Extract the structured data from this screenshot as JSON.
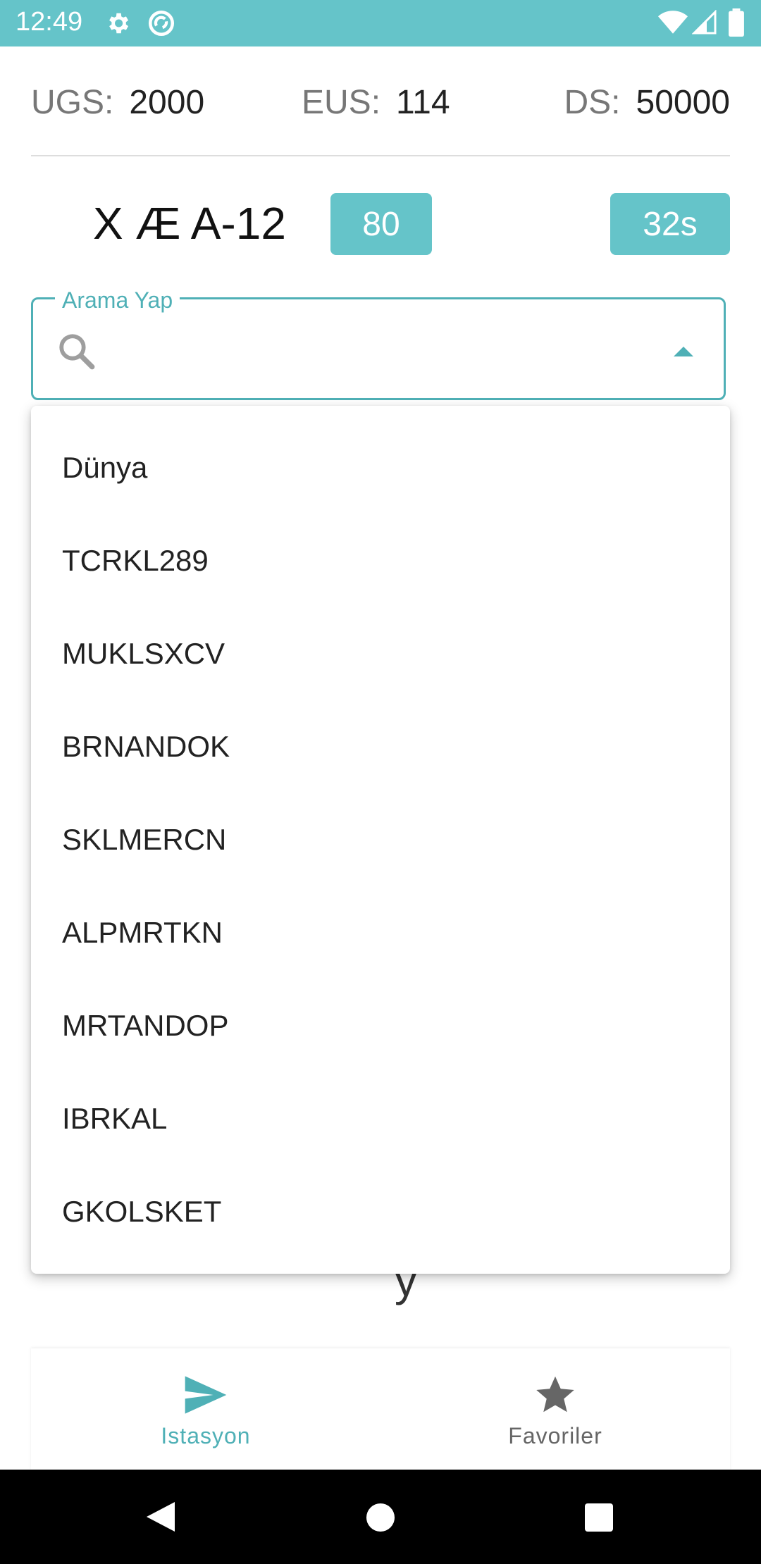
{
  "status_bar": {
    "time": "12:49",
    "icons": [
      "gear-icon",
      "sync-icon",
      "wifi-icon",
      "signal-icon",
      "battery-icon"
    ],
    "background": "#65c4c9"
  },
  "stats": {
    "ugs": {
      "label": "UGS:",
      "value": "2000"
    },
    "eus": {
      "label": "EUS:",
      "value": "114"
    },
    "ds": {
      "label": "DS:",
      "value": "50000"
    }
  },
  "header": {
    "title": "X Æ A-12",
    "badge_number": "80",
    "badge_seconds": "32s"
  },
  "search": {
    "label": "Arama Yap",
    "value": "",
    "placeholder": ""
  },
  "dropdown": {
    "items": [
      "Dünya",
      "TCRKL289",
      "MUKLSXCV",
      "BRNANDOK",
      "SKLMERCN",
      "ALPMRTKN",
      "MRTANDOP",
      "IBRKAL",
      "GKOLSKET"
    ]
  },
  "behind_text": "y",
  "bottom_nav": {
    "items": [
      {
        "label": "Istasyon",
        "icon": "send-icon",
        "active": true
      },
      {
        "label": "Favoriler",
        "icon": "star-icon",
        "active": false
      }
    ]
  },
  "colors": {
    "accent": "#65c4c9",
    "accent_dark": "#4fb0b6"
  }
}
